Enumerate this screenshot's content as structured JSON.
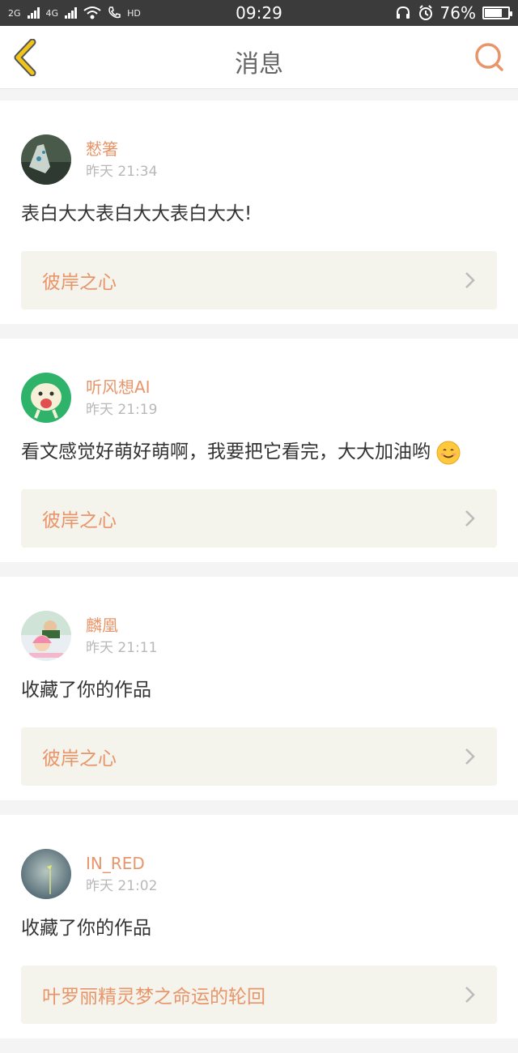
{
  "status_bar": {
    "net1": "2G",
    "net2": "4G",
    "hd": "HD",
    "time": "09:29",
    "battery": "76%",
    "battery_level": 0.76
  },
  "header": {
    "title": "消息"
  },
  "messages": [
    {
      "user": "慭箸",
      "time": "昨天 21:34",
      "text": "表白大大表白大大表白大大!",
      "work": "彼岸之心"
    },
    {
      "user": "听风想AI",
      "time": "昨天 21:19",
      "text": "看文感觉好萌好萌啊，我要把它看完，大大加油哟",
      "work": "彼岸之心"
    },
    {
      "user": "麟凰",
      "time": "昨天 21:11",
      "text": "收藏了你的作品",
      "work": "彼岸之心"
    },
    {
      "user": "IN_RED",
      "time": "昨天 21:02",
      "text": "收藏了你的作品",
      "work": "叶罗丽精灵梦之命运的轮回"
    }
  ],
  "colors": {
    "accent": "#e8956a",
    "back_arrow": "#f0c419"
  }
}
